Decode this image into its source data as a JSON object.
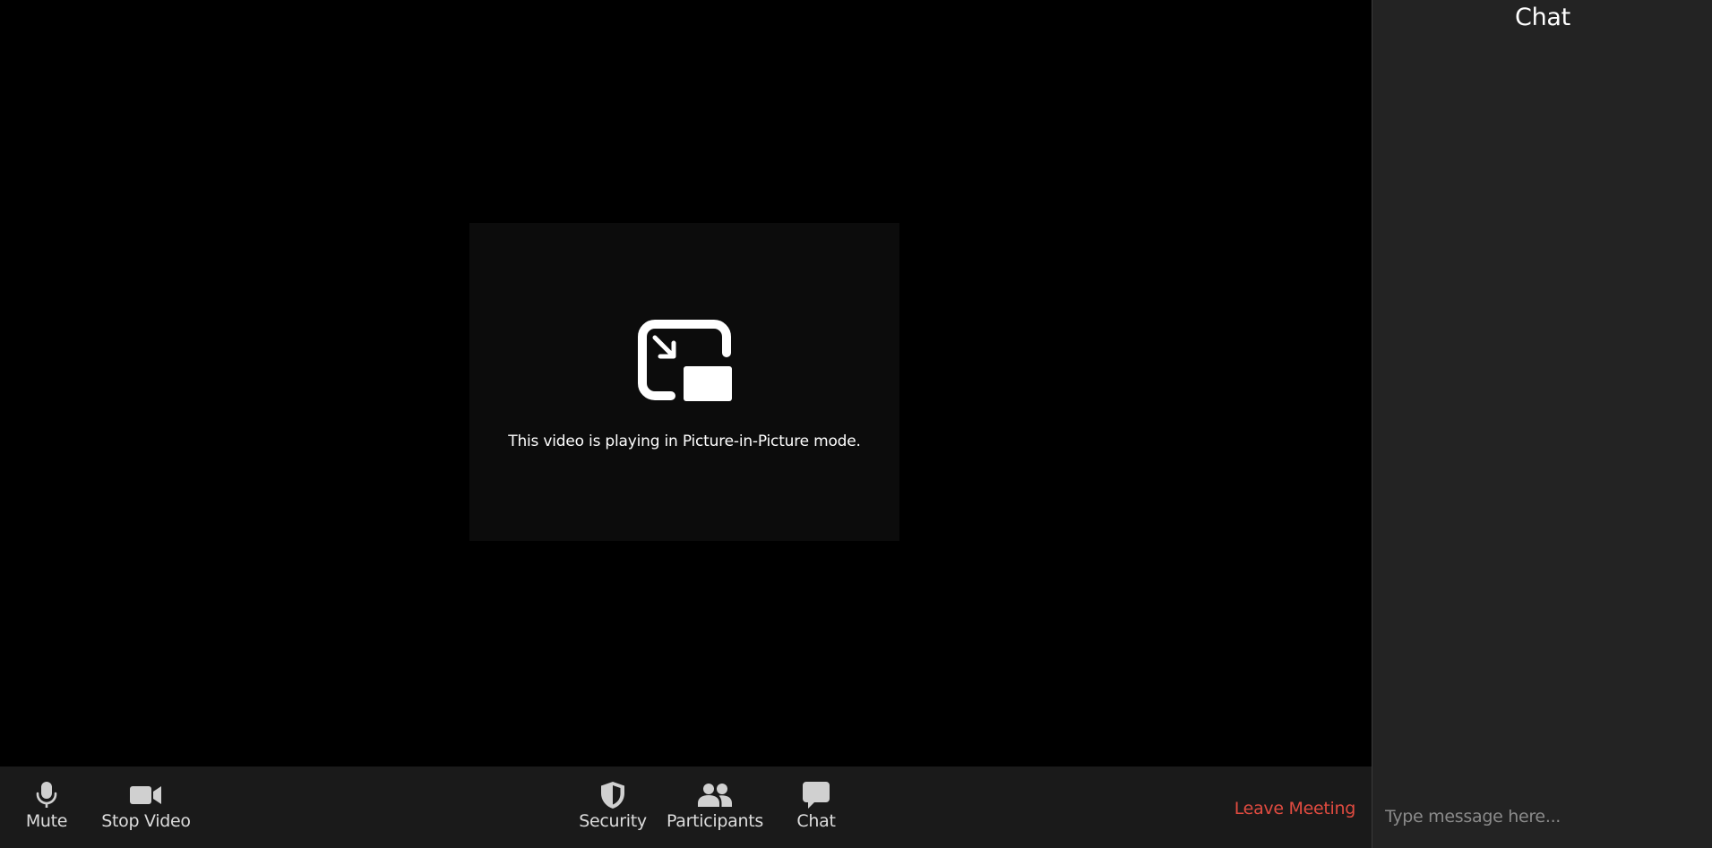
{
  "stage": {
    "pip_message": "This video is playing in Picture-in-Picture mode.",
    "pip_icon": "picture-in-picture-icon"
  },
  "toolbar": {
    "mute": {
      "label": "Mute",
      "icon": "microphone-icon"
    },
    "stop_video": {
      "label": "Stop Video",
      "icon": "video-camera-icon"
    },
    "security": {
      "label": "Security",
      "icon": "shield-icon"
    },
    "participants": {
      "label": "Participants",
      "icon": "people-icon"
    },
    "chat": {
      "label": "Chat",
      "icon": "chat-bubble-icon"
    },
    "leave_meeting": "Leave Meeting"
  },
  "chat_panel": {
    "title": "Chat",
    "input_placeholder": "Type message here..."
  },
  "colors": {
    "toolbar_bg": "#1a1a1a",
    "panel_bg": "#232323",
    "leave_red": "#e04b40",
    "icon_gray": "#d0d0d0"
  }
}
